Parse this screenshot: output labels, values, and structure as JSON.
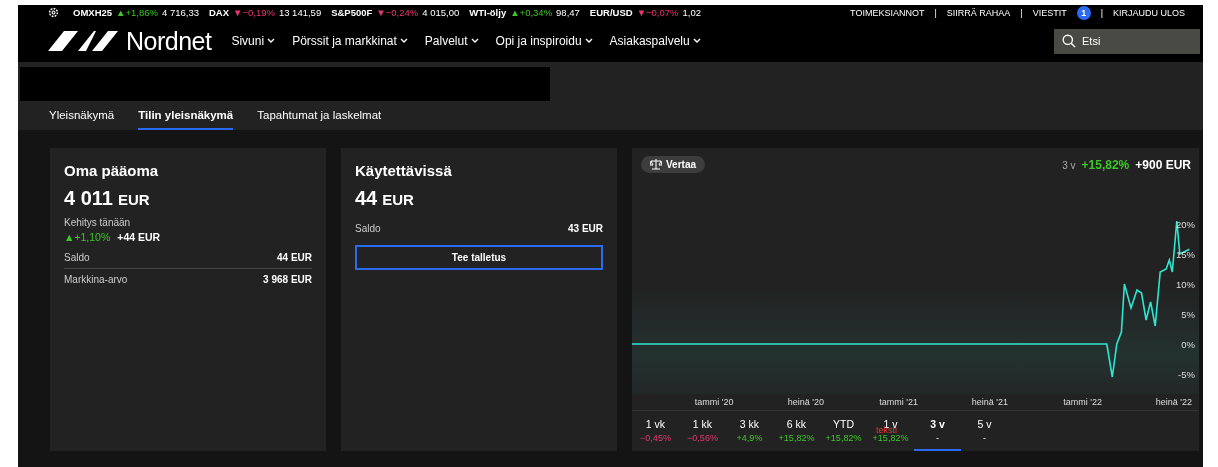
{
  "ticker": [
    {
      "name": "OMXH25",
      "change": "▲+1,86%",
      "kind": "gain",
      "value": "4 716,33"
    },
    {
      "name": "DAX",
      "change": "▼−0,19%",
      "kind": "loss",
      "value": "13 141,59"
    },
    {
      "name": "S&P500F",
      "change": "▼−0,24%",
      "kind": "loss",
      "value": "4 015,00"
    },
    {
      "name": "WTI-öljy",
      "change": "▲+0,34%",
      "kind": "gain",
      "value": "98,47"
    },
    {
      "name": "EUR/USD",
      "change": "▼−0,07%",
      "kind": "loss",
      "value": "1,02"
    }
  ],
  "top_links": [
    {
      "label": "TOIMEKSIANNOT"
    },
    {
      "separator": "|",
      "label": "SIIRRÄ RAHAA"
    },
    {
      "separator": "|",
      "label": "VIESTIT",
      "badge": "1"
    },
    {
      "separator": "|",
      "label": "KIRJAUDU ULOS"
    }
  ],
  "brand": "Nordnet",
  "nav": [
    "Sivuni",
    "Pörssit ja markkinat",
    "Palvelut",
    "Opi ja inspiroidu",
    "Asiakaspalvelu"
  ],
  "search": {
    "placeholder": "Etsi"
  },
  "tabs": [
    {
      "label": "Yleisnäkymä",
      "selected": false
    },
    {
      "label": "Tilin yleisnäkymä",
      "selected": true
    },
    {
      "label": "Tapahtumat ja laskelmat",
      "selected": false
    }
  ],
  "equity_card": {
    "title": "Oma pääoma",
    "amount": "4 011",
    "currency": "EUR",
    "today_label": "Kehitys tänään",
    "today_change": "▲+1,10%",
    "today_amount": "+44 EUR",
    "rows": [
      {
        "label": "Saldo",
        "value": "44 EUR"
      },
      {
        "label": "Markkina-arvo",
        "value": "3 968 EUR"
      }
    ]
  },
  "available_card": {
    "title": "Käytettävissä",
    "amount": "44",
    "currency": "EUR",
    "rows": [
      {
        "label": "Saldo",
        "value": "43 EUR"
      }
    ],
    "button": "Tee talletus"
  },
  "performance": {
    "compare_button": "Vertaa",
    "period": "3 v",
    "change": "+15,82%",
    "amount": "+900 EUR",
    "chart_data": {
      "type": "line",
      "x": [
        "2019-07-22",
        "2022-02-18",
        "2022-03-01",
        "2022-03-10",
        "2022-03-19",
        "2022-03-25",
        "2022-04-07",
        "2022-04-19",
        "2022-04-28",
        "2022-05-07",
        "2022-05-16",
        "2022-05-25",
        "2022-06-04",
        "2022-06-16",
        "2022-06-22",
        "2022-06-28",
        "2022-07-07",
        "2022-07-13",
        "2022-08-01"
      ],
      "series": [
        {
          "color": "#2ee6d0",
          "values": [
            0,
            0,
            -5.5,
            0,
            2,
            10,
            6,
            9,
            8.5,
            4,
            7,
            3,
            12,
            12.5,
            14,
            12,
            20.5,
            15,
            15.8
          ]
        }
      ],
      "xlim": [
        "2019-07-22",
        "2022-08-20"
      ],
      "ylim": [
        -17.75,
        32.75
      ],
      "xticks": [
        {
          "value": "2020-01-01",
          "label": "tammi '20"
        },
        {
          "value": "2020-07-01",
          "label": "heinä '20"
        },
        {
          "value": "2021-01-01",
          "label": "tammi '21"
        },
        {
          "value": "2021-07-01",
          "label": "heinä '21"
        },
        {
          "value": "2022-01-01",
          "label": "tammi '22"
        },
        {
          "value": "2022-07-01",
          "label": "heinä '22"
        }
      ],
      "yticks": [
        {
          "value": 20,
          "label": "20%"
        },
        {
          "value": 15,
          "label": "15%"
        },
        {
          "value": 10,
          "label": "10%"
        },
        {
          "value": 5,
          "label": "5%"
        },
        {
          "value": 0,
          "label": "0%"
        },
        {
          "value": -5,
          "label": "-5%"
        }
      ]
    },
    "periods": [
      {
        "label": "1 vk",
        "value": "−0,45%",
        "kind": "loss",
        "selected": false
      },
      {
        "label": "1 kk",
        "value": "−0,56%",
        "kind": "loss",
        "selected": false
      },
      {
        "label": "3 kk",
        "value": "+4,9%",
        "kind": "gain",
        "selected": false
      },
      {
        "label": "6 kk",
        "value": "+15,82%",
        "kind": "gain",
        "selected": false
      },
      {
        "label": "YTD",
        "value": "+15,82%",
        "kind": "gain",
        "selected": false
      },
      {
        "label": "1 v",
        "value": "+15,82%",
        "kind": "gain",
        "selected": false,
        "overlay_note": "teksti"
      },
      {
        "label": "3 v",
        "value": "-",
        "kind": "flat",
        "selected": true
      },
      {
        "label": "5 v",
        "value": "-",
        "kind": "flat",
        "selected": false
      }
    ]
  }
}
